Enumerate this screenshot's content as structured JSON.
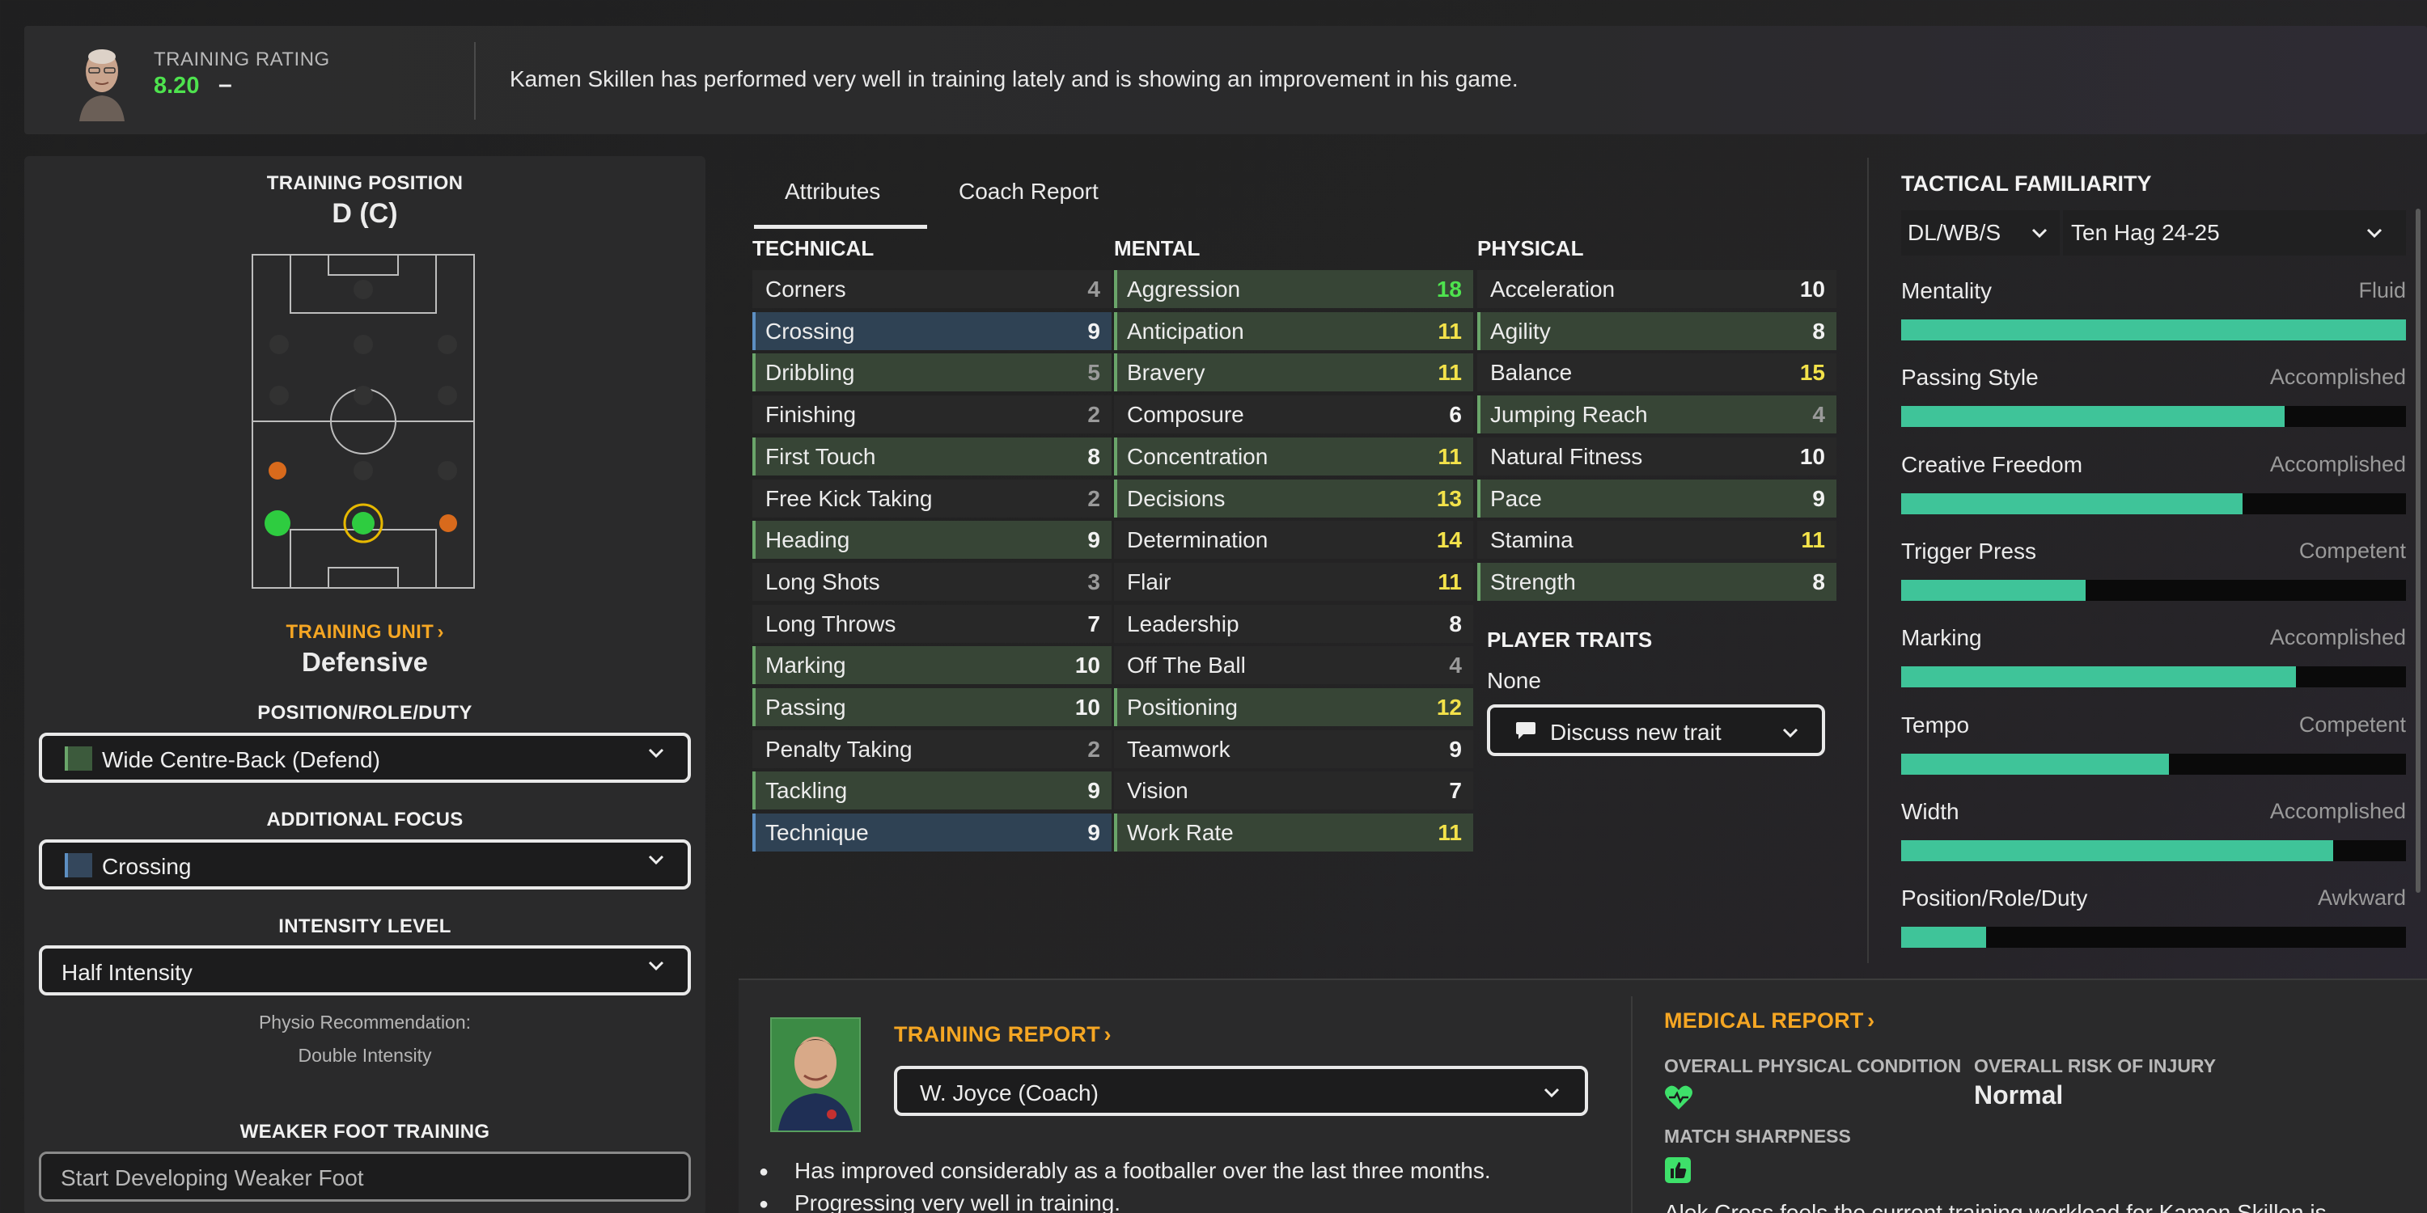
{
  "banner": {
    "rating_label": "TRAINING RATING",
    "rating_value": "8.20",
    "rating_trend": "–",
    "message": "Kamen Skillen has performed very well in training lately and is showing an improvement in his game."
  },
  "left": {
    "training_position_label": "TRAINING POSITION",
    "training_position_value": "D (C)",
    "training_unit_label": "TRAINING UNIT",
    "training_unit_value": "Defensive",
    "prd_label": "POSITION/ROLE/DUTY",
    "prd_value": "Wide Centre-Back (Defend)",
    "focus_label": "ADDITIONAL FOCUS",
    "focus_value": "Crossing",
    "intensity_label": "INTENSITY LEVEL",
    "intensity_value": "Half Intensity",
    "physio_line1": "Physio Recommendation:",
    "physio_line2": "Double Intensity",
    "weaker_foot_label": "WEAKER FOOT TRAINING",
    "weaker_foot_placeholder": "Start Developing Weaker Foot"
  },
  "tabs": [
    "Attributes",
    "Coach Report"
  ],
  "columns": {
    "technical": "TECHNICAL",
    "mental": "MENTAL",
    "physical": "PHYSICAL"
  },
  "technical": [
    {
      "name": "Corners",
      "value": "4"
    },
    {
      "name": "Crossing",
      "value": "9"
    },
    {
      "name": "Dribbling",
      "value": "5"
    },
    {
      "name": "Finishing",
      "value": "2"
    },
    {
      "name": "First Touch",
      "value": "8"
    },
    {
      "name": "Free Kick Taking",
      "value": "2"
    },
    {
      "name": "Heading",
      "value": "9"
    },
    {
      "name": "Long Shots",
      "value": "3"
    },
    {
      "name": "Long Throws",
      "value": "7"
    },
    {
      "name": "Marking",
      "value": "10"
    },
    {
      "name": "Passing",
      "value": "10"
    },
    {
      "name": "Penalty Taking",
      "value": "2"
    },
    {
      "name": "Tackling",
      "value": "9"
    },
    {
      "name": "Technique",
      "value": "9"
    }
  ],
  "mental": [
    {
      "name": "Aggression",
      "value": "18"
    },
    {
      "name": "Anticipation",
      "value": "11"
    },
    {
      "name": "Bravery",
      "value": "11"
    },
    {
      "name": "Composure",
      "value": "6"
    },
    {
      "name": "Concentration",
      "value": "11"
    },
    {
      "name": "Decisions",
      "value": "13"
    },
    {
      "name": "Determination",
      "value": "14"
    },
    {
      "name": "Flair",
      "value": "11"
    },
    {
      "name": "Leadership",
      "value": "8"
    },
    {
      "name": "Off The Ball",
      "value": "4"
    },
    {
      "name": "Positioning",
      "value": "12"
    },
    {
      "name": "Teamwork",
      "value": "9"
    },
    {
      "name": "Vision",
      "value": "7"
    },
    {
      "name": "Work Rate",
      "value": "11"
    }
  ],
  "physical": [
    {
      "name": "Acceleration",
      "value": "10"
    },
    {
      "name": "Agility",
      "value": "8"
    },
    {
      "name": "Balance",
      "value": "15"
    },
    {
      "name": "Jumping Reach",
      "value": "4"
    },
    {
      "name": "Natural Fitness",
      "value": "10"
    },
    {
      "name": "Pace",
      "value": "9"
    },
    {
      "name": "Stamina",
      "value": "11"
    },
    {
      "name": "Strength",
      "value": "8"
    }
  ],
  "traits": {
    "label": "PLAYER TRAITS",
    "value": "None",
    "button": "Discuss new trait"
  },
  "tactical": {
    "title": "TACTICAL FAMILIARITY",
    "position_select": "DL/WB/S",
    "tactic_select": "Ten Hag 24-25",
    "items": [
      {
        "name": "Mentality",
        "level": "Fluid",
        "fill": 1.0
      },
      {
        "name": "Passing Style",
        "level": "Accomplished",
        "fill": 0.76
      },
      {
        "name": "Creative Freedom",
        "level": "Accomplished",
        "fill": 0.676
      },
      {
        "name": "Trigger Press",
        "level": "Competent",
        "fill": 0.365
      },
      {
        "name": "Marking",
        "level": "Accomplished",
        "fill": 0.782
      },
      {
        "name": "Tempo",
        "level": "Competent",
        "fill": 0.53
      },
      {
        "name": "Width",
        "level": "Accomplished",
        "fill": 0.855
      },
      {
        "name": "Position/Role/Duty",
        "level": "Awkward",
        "fill": 0.168
      }
    ]
  },
  "training_report": {
    "title": "TRAINING REPORT",
    "coach_select": "W. Joyce (Coach)",
    "bullets": [
      "Has improved considerably as a footballer over the last three months.",
      "Progressing very well in training."
    ]
  },
  "medical": {
    "title": "MEDICAL REPORT",
    "physical_label": "OVERALL PHYSICAL CONDITION",
    "risk_label": "OVERALL RISK OF INJURY",
    "risk_value": "Normal",
    "sharpness_label": "MATCH SHARPNESS",
    "note": "Alek Cross feels the current training workload for Kamen Skillen is"
  }
}
